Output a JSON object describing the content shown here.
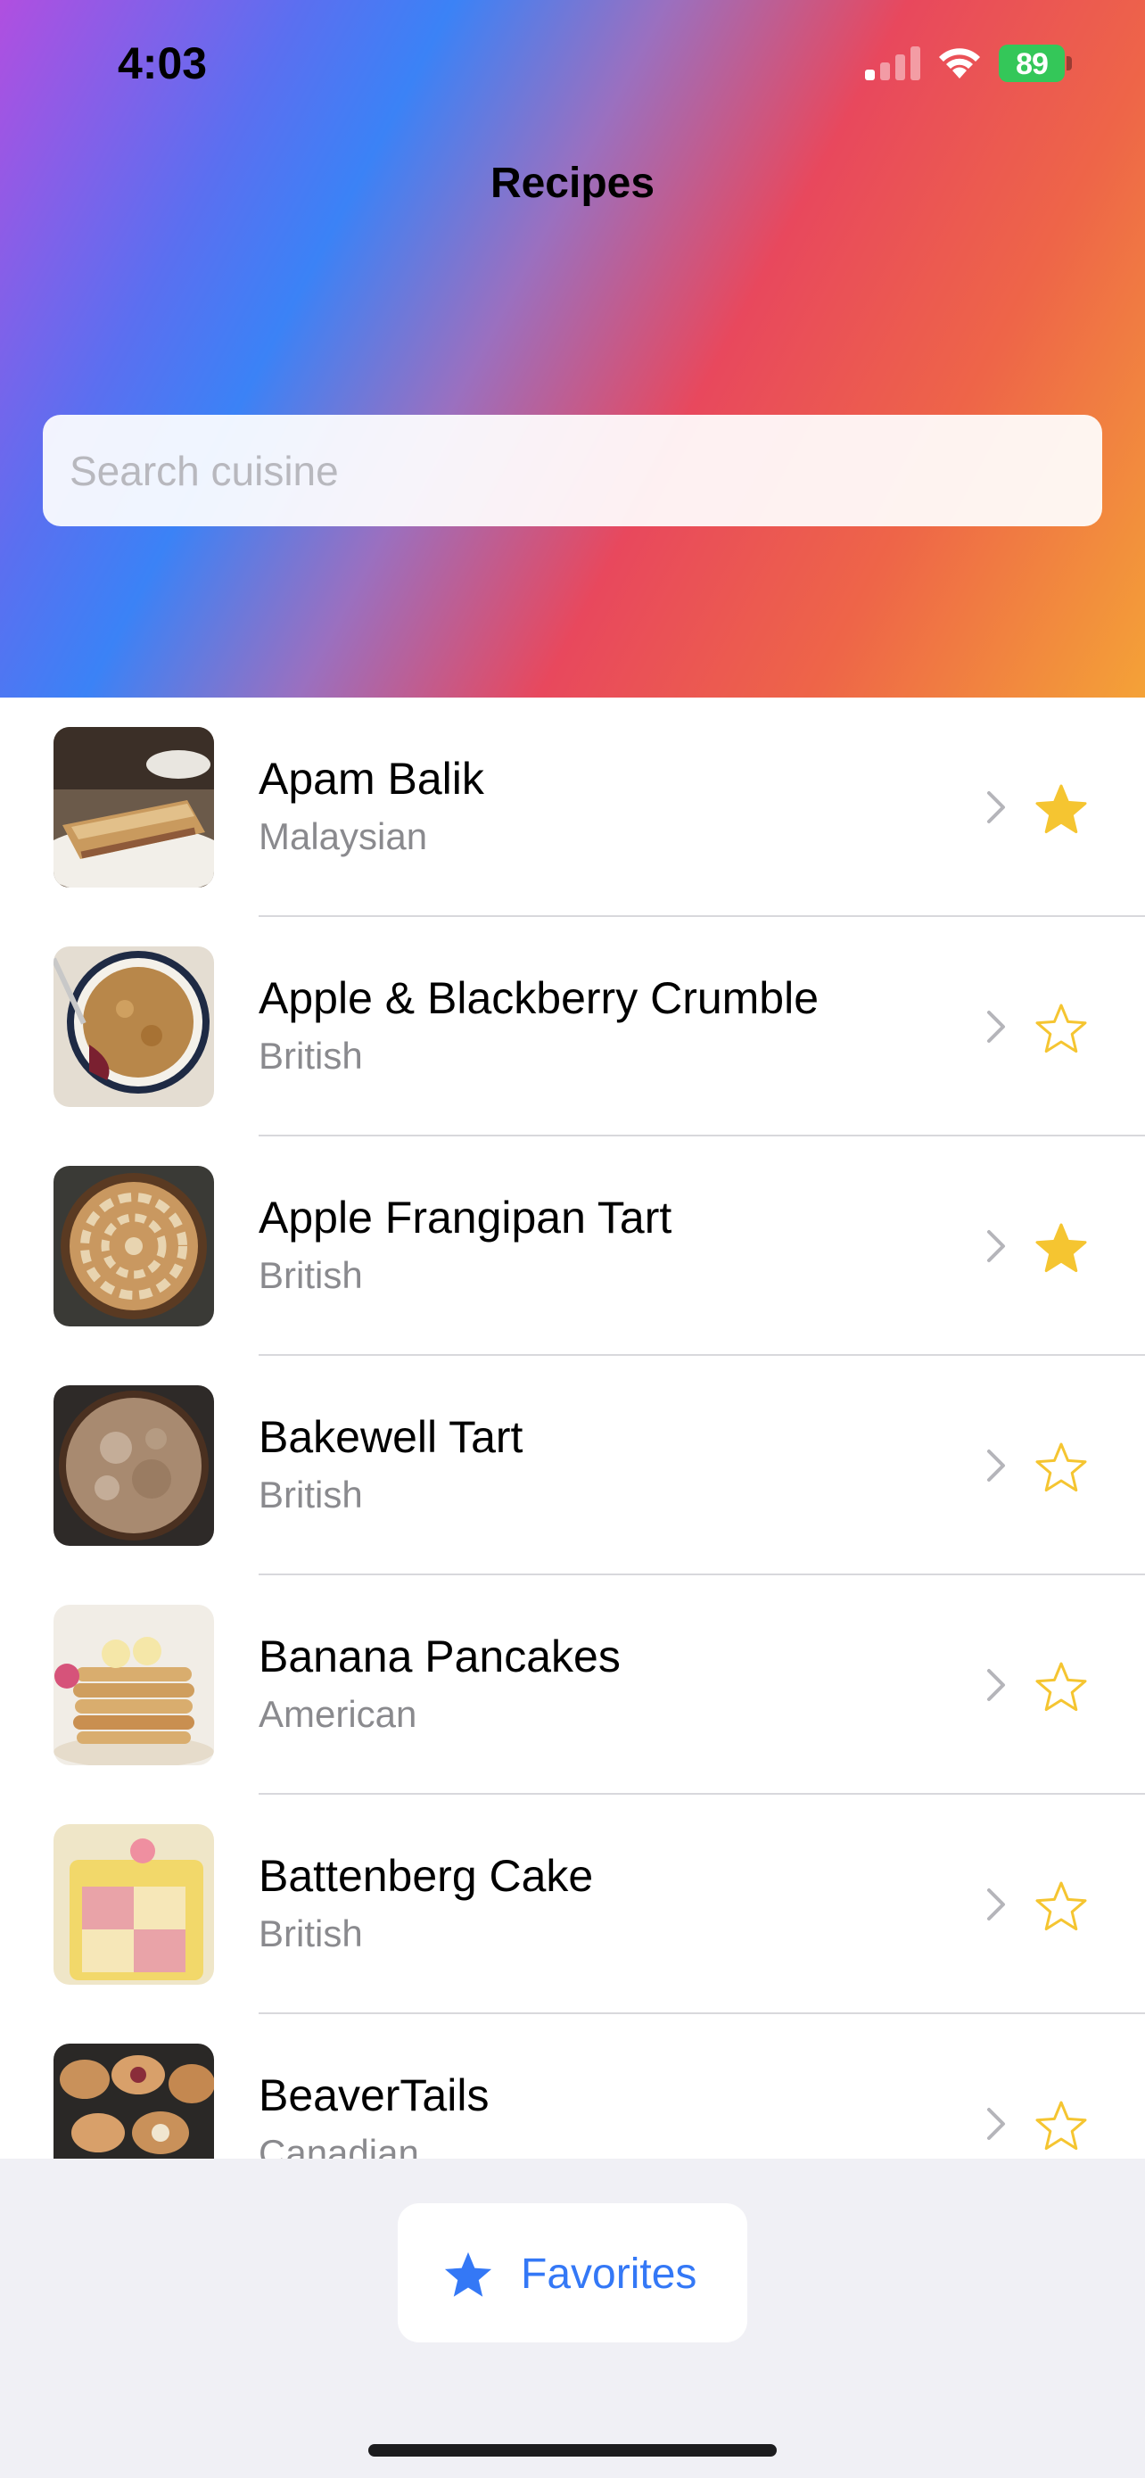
{
  "status_bar": {
    "time": "4:03",
    "battery": "89",
    "battery_color": "#34c759"
  },
  "nav": {
    "title": "Recipes"
  },
  "search": {
    "placeholder": "Search cuisine",
    "value": ""
  },
  "recipes": [
    {
      "name": "Apam Balik",
      "cuisine": "Malaysian",
      "favorite": true
    },
    {
      "name": "Apple & Blackberry Crumble",
      "cuisine": "British",
      "favorite": false
    },
    {
      "name": "Apple Frangipan Tart",
      "cuisine": "British",
      "favorite": true
    },
    {
      "name": "Bakewell Tart",
      "cuisine": "British",
      "favorite": false
    },
    {
      "name": "Banana Pancakes",
      "cuisine": "American",
      "favorite": false
    },
    {
      "name": "Battenberg Cake",
      "cuisine": "British",
      "favorite": false
    },
    {
      "name": "BeaverTails",
      "cuisine": "Canadian",
      "favorite": false
    }
  ],
  "favorites_button": {
    "label": "Favorites",
    "icon": "star-fill-icon"
  },
  "colors": {
    "accent": "#3478f6",
    "star": "#f5c531",
    "header_gradient": [
      "#b04fe0",
      "#3b82f6",
      "#e8485d",
      "#f4a237"
    ]
  }
}
